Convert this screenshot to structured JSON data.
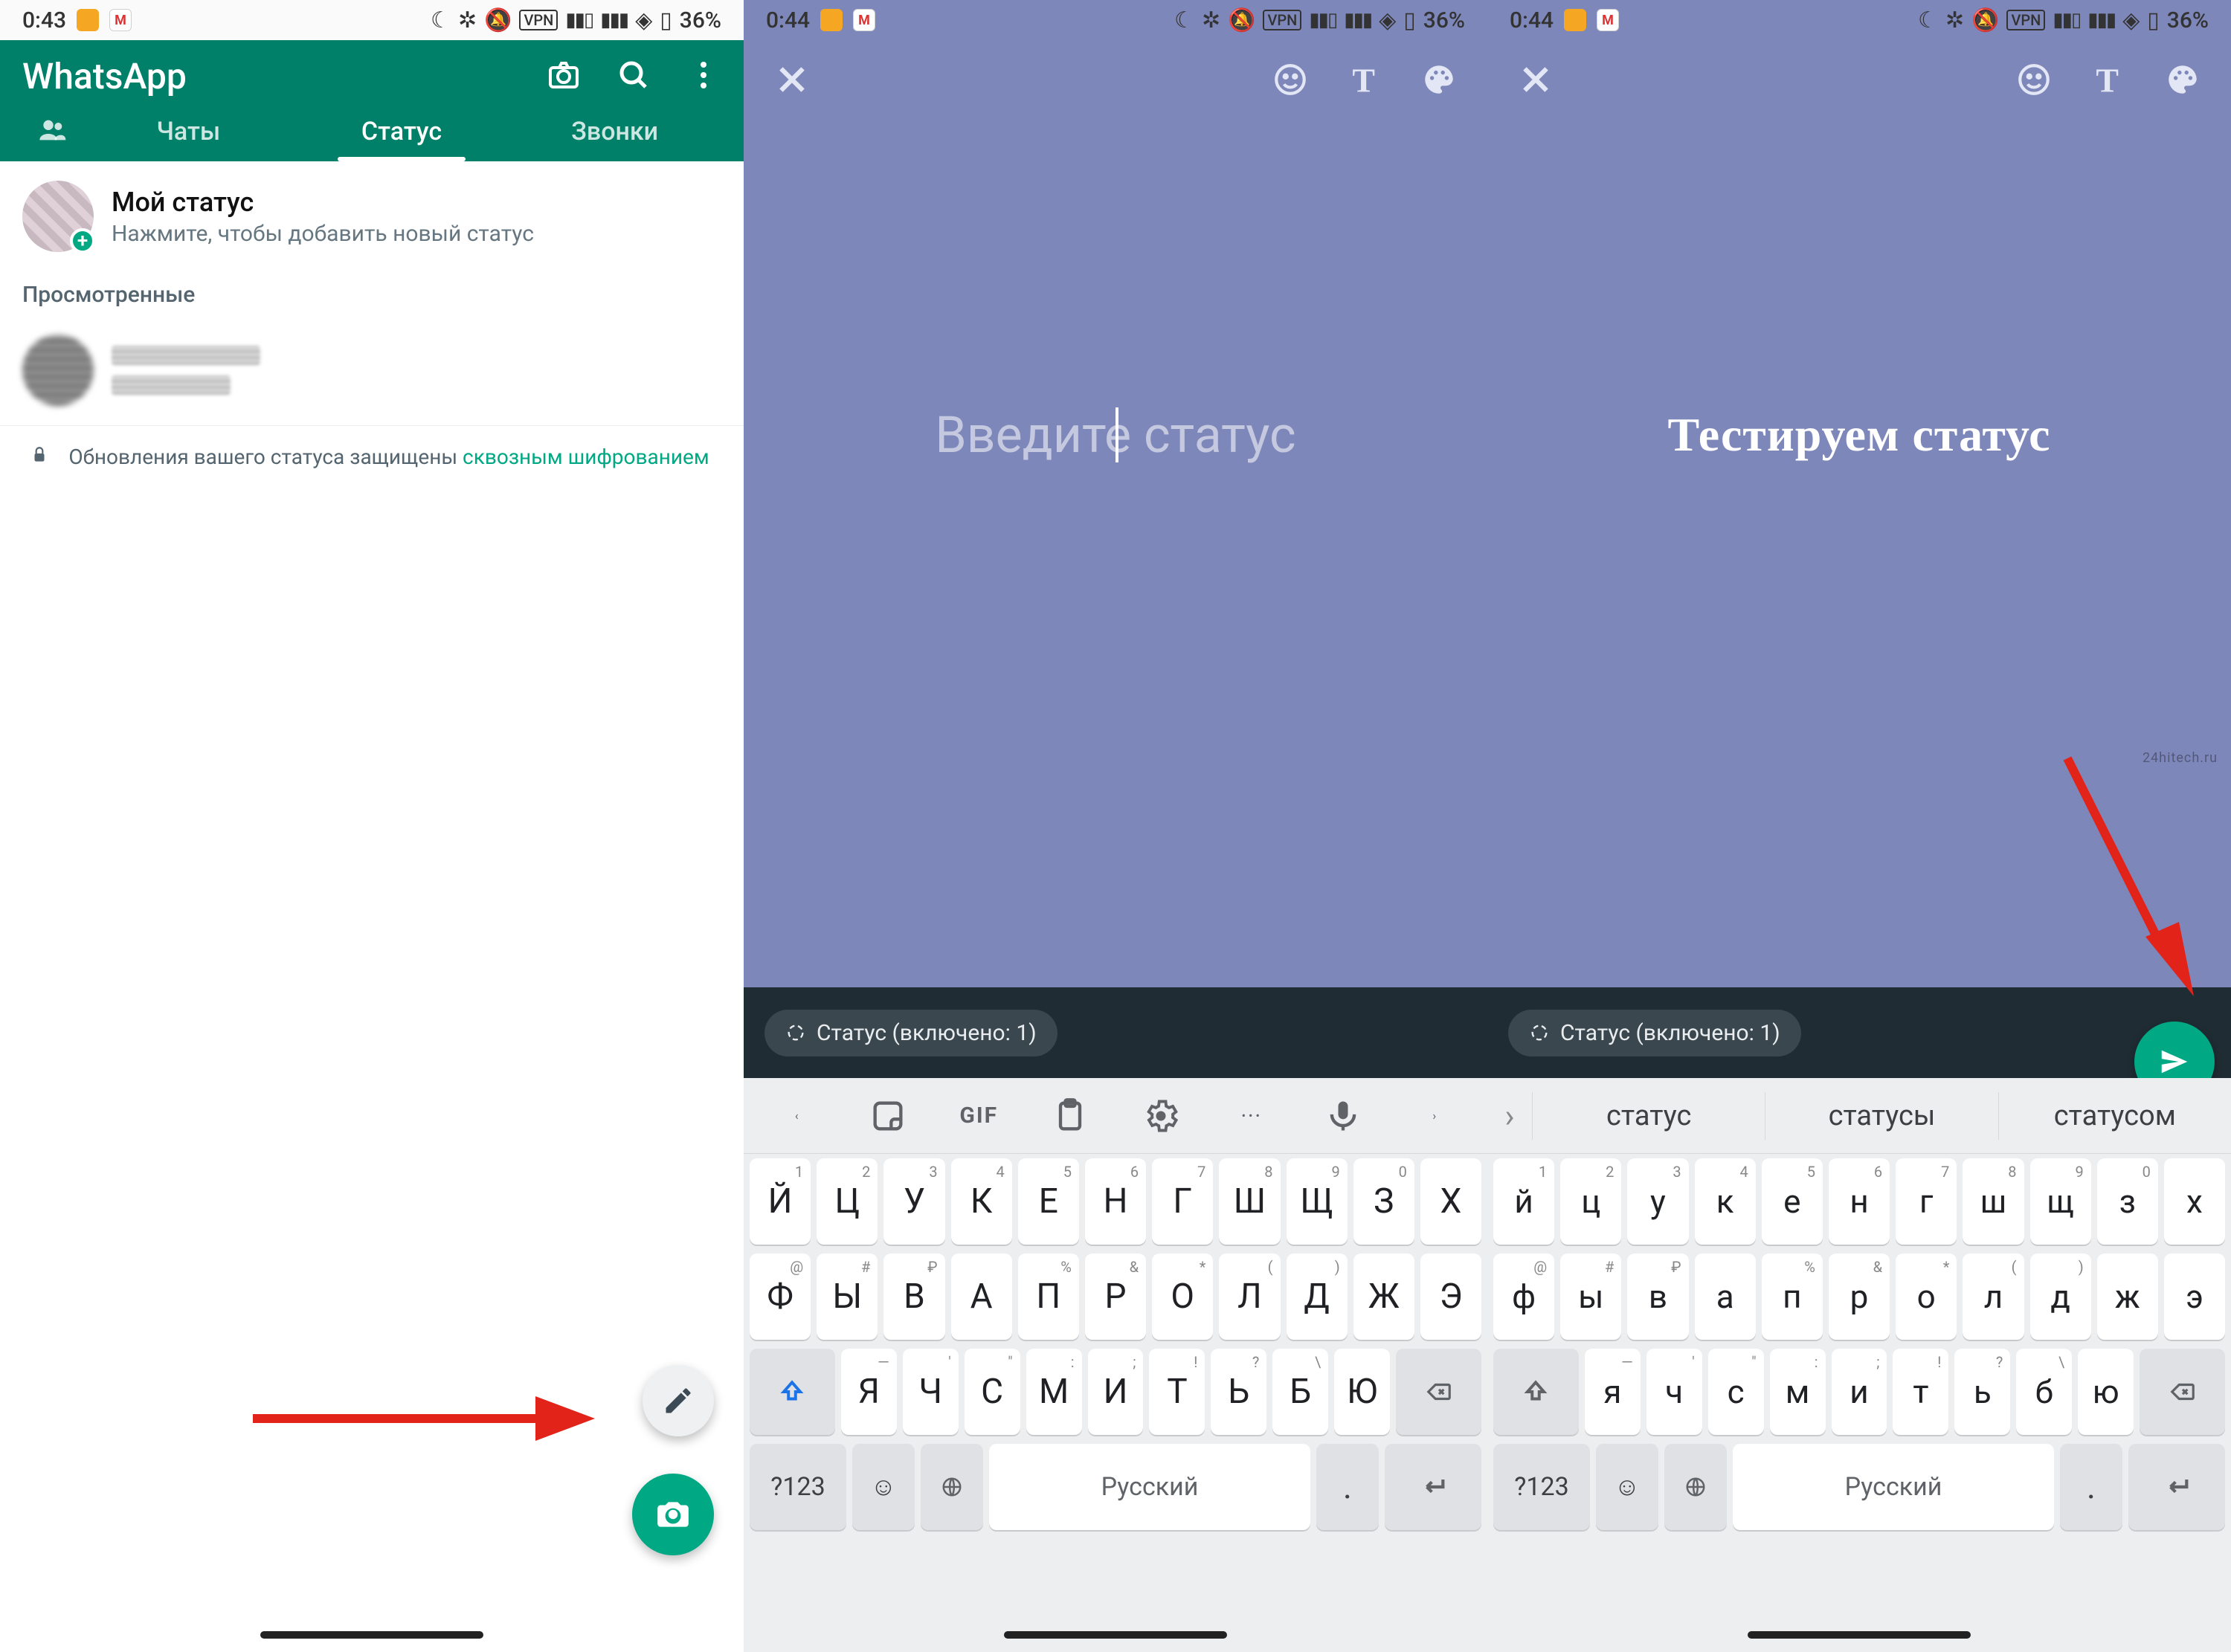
{
  "statusbar": {
    "time1": "0:43",
    "time2": "0:44",
    "time3": "0:44",
    "battery": "36%"
  },
  "wa": {
    "title": "WhatsApp",
    "tabs": {
      "chats": "Чаты",
      "status": "Статус",
      "calls": "Звонки"
    },
    "my_status_title": "Мой статус",
    "my_status_sub": "Нажмите, чтобы добавить новый статус",
    "viewed_label": "Просмотренные",
    "e2e_prefix": "Обновления вашего статуса защищены ",
    "e2e_link": "сквозным шифрованием"
  },
  "editor": {
    "placeholder": "Введите статус",
    "typed": "Тестируем статус",
    "chip_prefix": "Статус (включено: ",
    "chip_count": "1",
    "chip_suffix": ")"
  },
  "keyboard": {
    "toolbar_gif": "GIF",
    "row1": [
      "й",
      "ц",
      "у",
      "к",
      "е",
      "н",
      "г",
      "ш",
      "щ",
      "з",
      "х"
    ],
    "row1_upper": [
      "Й",
      "Ц",
      "У",
      "К",
      "Е",
      "Н",
      "Г",
      "Ш",
      "Щ",
      "З",
      "Х"
    ],
    "sup1": [
      "1",
      "2",
      "3",
      "4",
      "5",
      "6",
      "7",
      "8",
      "9",
      "0",
      ""
    ],
    "row2": [
      "ф",
      "ы",
      "в",
      "а",
      "п",
      "р",
      "о",
      "л",
      "д",
      "ж",
      "э"
    ],
    "row2_upper": [
      "Ф",
      "Ы",
      "В",
      "А",
      "П",
      "Р",
      "О",
      "Л",
      "Д",
      "Ж",
      "Э"
    ],
    "sup2": [
      "@",
      "#",
      "₽",
      "",
      "%",
      "&",
      "*",
      "(",
      ")",
      "",
      ""
    ],
    "row3": [
      "я",
      "ч",
      "с",
      "м",
      "и",
      "т",
      "ь",
      "б",
      "ю"
    ],
    "row3_upper": [
      "Я",
      "Ч",
      "С",
      "М",
      "И",
      "Т",
      "Ь",
      "Б",
      "Ю"
    ],
    "sup3": [
      "—",
      "'",
      "\"",
      ":",
      ";",
      "!",
      "?",
      "\\",
      ""
    ],
    "sym": "?123",
    "space_label": "Русский",
    "dot": "."
  },
  "suggestions": [
    "статус",
    "статусы",
    "статусом"
  ],
  "watermark": "24hitech.ru"
}
